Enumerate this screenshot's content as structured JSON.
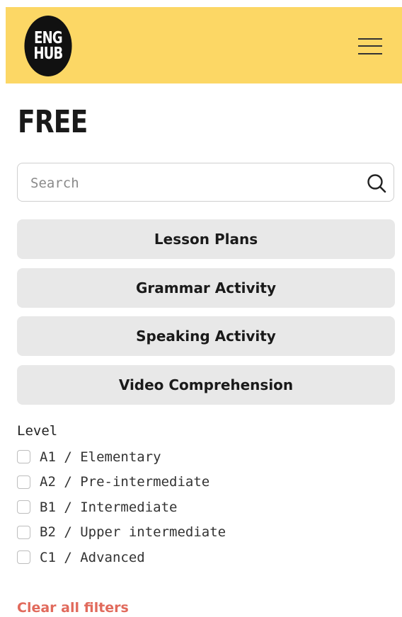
{
  "header": {
    "logo_line1": "ENG",
    "logo_line2": "HUB",
    "background_color": "#fcd765",
    "menu_icon": "hamburger-menu-icon"
  },
  "page": {
    "title": "FREE"
  },
  "search": {
    "placeholder": "Search",
    "icon": "search-icon"
  },
  "categories": [
    {
      "label": "Lesson Plans"
    },
    {
      "label": "Grammar Activity"
    },
    {
      "label": "Speaking Activity"
    },
    {
      "label": "Video Comprehension"
    }
  ],
  "level_filter": {
    "heading": "Level",
    "options": [
      {
        "label": "A1 / Elementary",
        "checked": false
      },
      {
        "label": "A2 / Pre-intermediate",
        "checked": false
      },
      {
        "label": "B1 / Intermediate",
        "checked": false
      },
      {
        "label": "B2 / Upper intermediate",
        "checked": false
      },
      {
        "label": "C1 / Advanced",
        "checked": false
      }
    ]
  },
  "clear_filters": {
    "label": "Clear all filters",
    "color": "#e16a5c"
  }
}
